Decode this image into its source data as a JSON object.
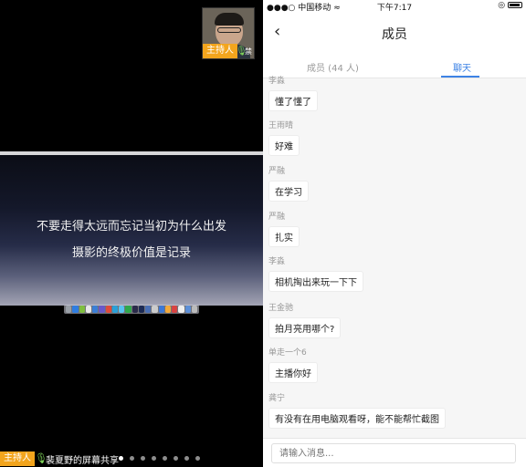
{
  "left": {
    "host_tag": "主持人",
    "host_mute": "禁",
    "slide": {
      "line1": "不要走得太远而忘记当初为什么出发",
      "line2": "摄影的终极价值是记录"
    },
    "bottom": {
      "host_tag": "主持人",
      "share_label": "裴夏野的屏幕共享"
    }
  },
  "phone": {
    "status": {
      "carrier": "中国移动",
      "time": "下午7:17"
    },
    "title": "成员",
    "tabs": [
      {
        "label": "成员 (44 人)"
      },
      {
        "label": "聊天"
      }
    ],
    "messages": [
      {
        "sender": "李淼",
        "text": "懂了懂了"
      },
      {
        "sender": "王雨晴",
        "text": "好难"
      },
      {
        "sender": "严融",
        "text": "在学习"
      },
      {
        "sender": "严融",
        "text": "扎实"
      },
      {
        "sender": "李淼",
        "text": "相机掏出来玩一下下"
      },
      {
        "sender": "王金驰",
        "text": "拍月亮用哪个?"
      },
      {
        "sender": "单走一个6",
        "text": "主播你好"
      },
      {
        "sender": "龚宁",
        "text": "有没有在用电脑观看呀，能不能帮忙截图"
      }
    ],
    "input_placeholder": "请输入消息..."
  }
}
